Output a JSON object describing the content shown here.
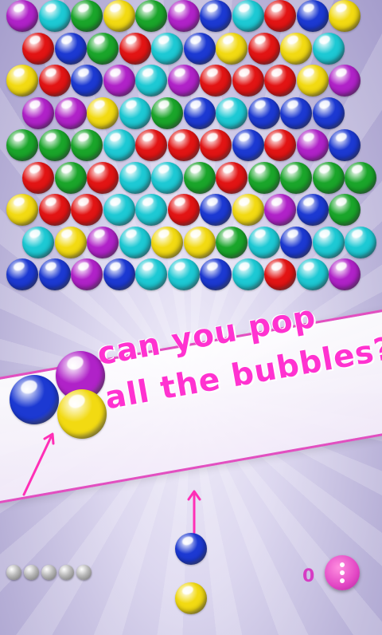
{
  "colors": {
    "P": "#b022c8",
    "C": "#1dc9d4",
    "G": "#1aa52a",
    "Y": "#f2da12",
    "B": "#1c39d2",
    "R": "#e21414"
  },
  "grid": {
    "rows": [
      "PCGYGPBCRBY",
      "RBGRCBYRYC",
      "YRBPCPRRRYP",
      "PPYCGBCBBB",
      "GGGCRRRBRPB",
      "RGRCCGRGGGG",
      "YRRCCRBYPBG",
      "CYPCYYGCBCC",
      "BBPBCCBCRCP"
    ]
  },
  "promo": {
    "line1": "can you pop",
    "line2": "all the bubbles?"
  },
  "promo_bubbles": [
    "B",
    "P",
    "Y"
  ],
  "shooter": {
    "current": "B",
    "next": "Y"
  },
  "lives": {
    "remaining": 5
  },
  "score": {
    "value": "0"
  },
  "menu": {
    "icon": "more-vert-icon"
  }
}
